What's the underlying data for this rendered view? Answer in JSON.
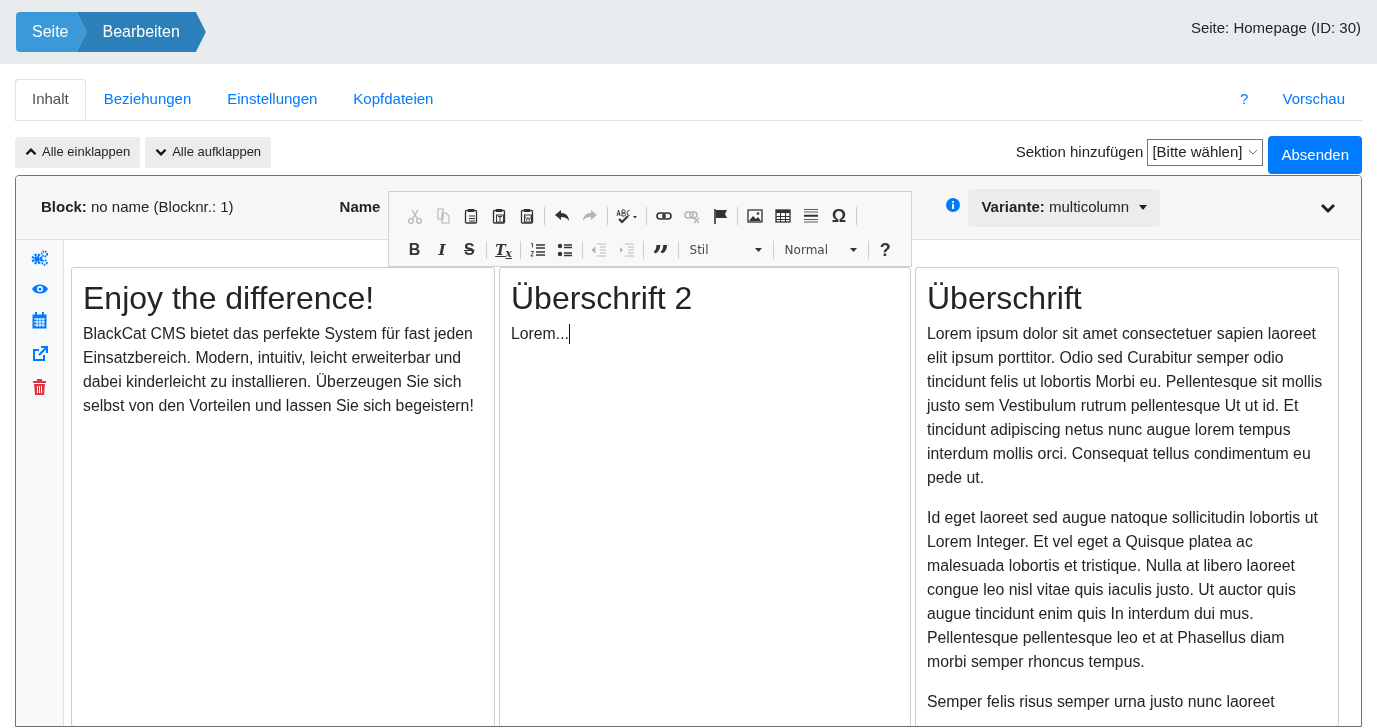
{
  "breadcrumb": [
    {
      "label": "Seite"
    },
    {
      "label": "Bearbeiten"
    }
  ],
  "page_info": "Seite: Homepage (ID: 30)",
  "tabs": [
    {
      "label": "Inhalt",
      "selected": true
    },
    {
      "label": "Beziehungen",
      "selected": false
    },
    {
      "label": "Einstellungen",
      "selected": false
    },
    {
      "label": "Kopfdateien",
      "selected": false
    }
  ],
  "right_links": [
    "?",
    "Vorschau"
  ],
  "collapse_buttons": [
    {
      "kind": "up",
      "label": "Alle einklappen"
    },
    {
      "kind": "down",
      "label": "Alle aufklappen"
    }
  ],
  "add_section": {
    "label": "Sektion hinzufügen",
    "value": "[Bitte wählen]"
  },
  "submit": "Absenden",
  "block": {
    "label": "Block:",
    "name": "no name (Blocknr.: 1)",
    "name_label": "Name",
    "variant_label": "Variante:",
    "variant": "multicolumn"
  },
  "toolbar": [
    [
      {
        "kind": "cut",
        "disabled": true
      },
      {
        "kind": "copy",
        "disabled": true
      },
      {
        "kind": "paste",
        "disabled": false
      },
      {
        "kind": "paste_text",
        "disabled": false
      },
      {
        "kind": "paste_word",
        "disabled": false
      },
      {
        "kind": "sep"
      },
      {
        "kind": "undo",
        "disabled": false
      },
      {
        "kind": "redo",
        "disabled": true
      },
      {
        "kind": "sep"
      },
      {
        "kind": "spellcheck",
        "disabled": false
      },
      {
        "kind": "sep"
      },
      {
        "kind": "link",
        "disabled": false
      },
      {
        "kind": "unlink",
        "disabled": true
      },
      {
        "kind": "anchor",
        "disabled": false
      },
      {
        "kind": "sep"
      },
      {
        "kind": "image",
        "disabled": false
      },
      {
        "kind": "table",
        "disabled": false
      },
      {
        "kind": "hr",
        "disabled": false
      },
      {
        "kind": "char",
        "label": "Ω",
        "disabled": false
      },
      {
        "kind": "sep"
      }
    ],
    [
      {
        "kind": "bold",
        "label": "B",
        "disabled": false
      },
      {
        "kind": "italic",
        "label": "I",
        "disabled": false
      },
      {
        "kind": "strike",
        "label": "S",
        "disabled": false
      },
      {
        "kind": "sep"
      },
      {
        "kind": "clear",
        "label": "T$_{x}$",
        "disabled": false
      },
      {
        "kind": "sep"
      },
      {
        "kind": "ol",
        "disabled": false
      },
      {
        "kind": "ul",
        "disabled": false
      },
      {
        "kind": "sep"
      },
      {
        "kind": "outdent",
        "disabled": true
      },
      {
        "kind": "indent",
        "disabled": true
      },
      {
        "kind": "sep"
      },
      {
        "kind": "quote",
        "label": "”",
        "disabled": false
      },
      {
        "kind": "sep"
      },
      {
        "kind": "combo",
        "label": "Stil"
      },
      {
        "kind": "sep"
      },
      {
        "kind": "combo",
        "label": "Normal"
      },
      {
        "kind": "sep"
      },
      {
        "kind": "help",
        "label": "?",
        "disabled": false
      }
    ]
  ],
  "columns": [
    {
      "heading": "Enjoy the difference!",
      "paragraphs": [
        "BlackCat CMS bietet das perfekte System für fast jeden Einsatzbereich. Modern, intuitiv, leicht erweiterbar und dabei kinderleicht zu installieren. Überzeugen Sie sich selbst von den Vorteilen und lassen Sie sich begeistern!"
      ],
      "cursor": false
    },
    {
      "heading": "Überschrift 2",
      "paragraphs": [
        "Lorem..."
      ],
      "cursor": true
    },
    {
      "heading": "Überschrift",
      "paragraphs": [
        "Lorem ipsum dolor sit amet consectetuer sapien laoreet elit ipsum porttitor. Odio sed Curabitur semper odio tincidunt felis ut lobortis Morbi eu. Pellentesque sit mollis justo sem Vestibulum rutrum pellentesque Ut ut id. Et tincidunt adipiscing netus nunc augue lorem tempus interdum mollis orci. Consequat tellus condimentum eu pede ut.",
        "Id eget laoreet sed augue natoque sollicitudin lobortis ut Lorem Integer. Et vel eget a Quisque platea ac malesuada lobortis et tristique. Nulla at libero laoreet congue leo nisl vitae quis iaculis justo. Ut auctor quis augue tincidunt enim quis In interdum dui mus. Pellentesque pellentesque leo et at Phasellus diam morbi semper rhoncus tempus.",
        "Semper felis risus semper urna justo nunc laoreet"
      ],
      "cursor": false
    }
  ]
}
